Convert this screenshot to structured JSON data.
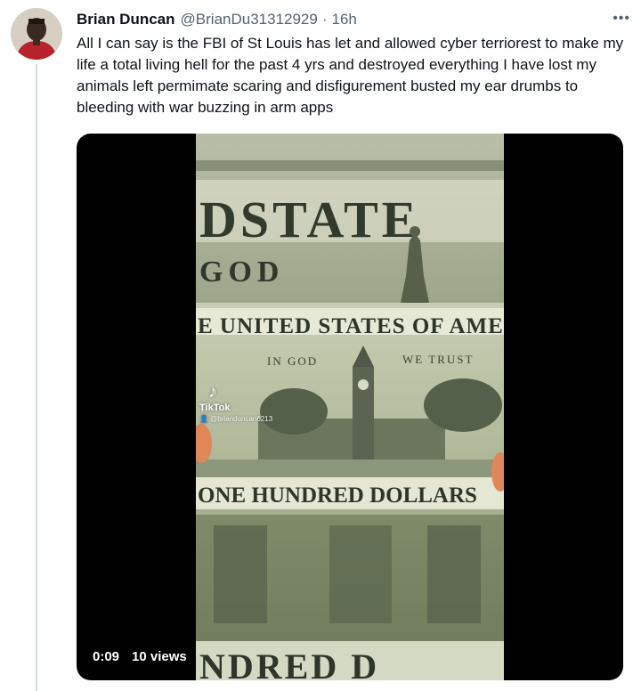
{
  "tweet": {
    "display_name": "Brian Duncan",
    "handle": "@BrianDu31312929",
    "separator": "·",
    "time": "16h",
    "more_icon": "•••",
    "text": "All I can say is the FBI of St Louis has let and allowed cyber terriorest to make my life a total living hell for the past 4 yrs and destroyed everything I have lost my animals left permimate scaring and disfigurement busted my ear drumbs to bleeding with war buzzing in arm apps"
  },
  "video": {
    "duration": "0:09",
    "views": "10 views",
    "watermark": {
      "logo_icon": "♪",
      "brand": "TikTok",
      "user": "👤 @brianduncan6213"
    },
    "bill_text": {
      "top_banner": "DSTATE",
      "top_motto": "GOD",
      "banner": "E UNITED STATES OF AME",
      "motto_left": "IN GOD",
      "motto_right": "WE TRUST",
      "denomination": "ONE HUNDRED DOLLARS",
      "bottom_banner": "NDRED D"
    }
  },
  "colors": {
    "text_primary": "#0f1419",
    "text_secondary": "#536471",
    "thread_line": "#cfd9de",
    "bill_green": "#9fa98a"
  }
}
